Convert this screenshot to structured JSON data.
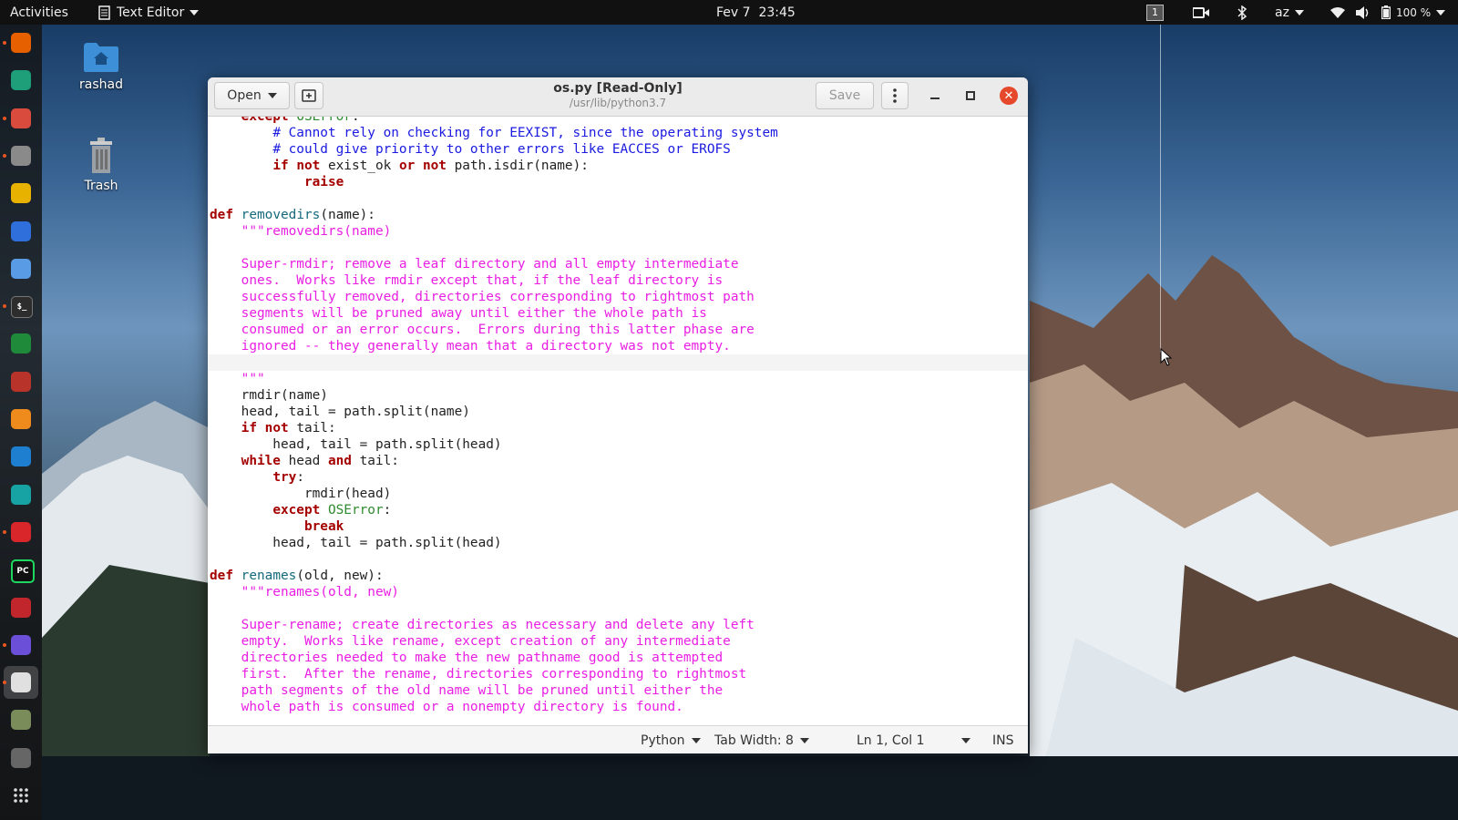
{
  "topbar": {
    "activities": "Activities",
    "app_menu": "Text Editor",
    "clock": "Fev 7  23:45",
    "workspace": "1",
    "keyboard_layout": "az",
    "battery": "100 %"
  },
  "desktop": {
    "home_label": "rashad",
    "trash_label": "Trash"
  },
  "window": {
    "open_label": "Open",
    "title": "os.py [Read-Only]",
    "subtitle": "/usr/lib/python3.7",
    "save_label": "Save"
  },
  "code_lines": [
    [
      {
        "t": "    "
      },
      {
        "t": "except",
        "c": "kw"
      },
      {
        "t": " "
      },
      {
        "t": "OSError",
        "c": "ex"
      },
      {
        "t": ":"
      }
    ],
    [
      {
        "t": "        "
      },
      {
        "t": "# Cannot rely on checking for EEXIST, since the operating system",
        "c": "cm"
      }
    ],
    [
      {
        "t": "        "
      },
      {
        "t": "# could give priority to other errors like EACCES or EROFS",
        "c": "cm"
      }
    ],
    [
      {
        "t": "        "
      },
      {
        "t": "if",
        "c": "kw"
      },
      {
        "t": " "
      },
      {
        "t": "not",
        "c": "kw"
      },
      {
        "t": " exist_ok "
      },
      {
        "t": "or",
        "c": "kw"
      },
      {
        "t": " "
      },
      {
        "t": "not",
        "c": "kw"
      },
      {
        "t": " path.isdir(name):"
      }
    ],
    [
      {
        "t": "            "
      },
      {
        "t": "raise",
        "c": "kw"
      }
    ],
    [
      {
        "t": ""
      }
    ],
    [
      {
        "t": "def",
        "c": "kw"
      },
      {
        "t": " "
      },
      {
        "t": "removedirs",
        "c": "fn"
      },
      {
        "t": "(name):"
      }
    ],
    [
      {
        "t": "    "
      },
      {
        "t": "\"\"\"removedirs(name)",
        "c": "st"
      }
    ],
    [
      {
        "t": ""
      }
    ],
    [
      {
        "t": "    "
      },
      {
        "t": "Super-rmdir; remove a leaf directory and all empty intermediate",
        "c": "st"
      }
    ],
    [
      {
        "t": "    "
      },
      {
        "t": "ones.  Works like rmdir except that, if the leaf directory is",
        "c": "st"
      }
    ],
    [
      {
        "t": "    "
      },
      {
        "t": "successfully removed, directories corresponding to rightmost path",
        "c": "st"
      }
    ],
    [
      {
        "t": "    "
      },
      {
        "t": "segments will be pruned away until either the whole path is",
        "c": "st"
      }
    ],
    [
      {
        "t": "    "
      },
      {
        "t": "consumed or an error occurs.  Errors during this latter phase are",
        "c": "st"
      }
    ],
    [
      {
        "t": "    "
      },
      {
        "t": "ignored -- they generally mean that a directory was not empty.",
        "c": "st"
      }
    ],
    [
      {
        "t": ""
      }
    ],
    [
      {
        "t": "    "
      },
      {
        "t": "\"\"\"",
        "c": "st"
      }
    ],
    [
      {
        "t": "    rmdir(name)"
      }
    ],
    [
      {
        "t": "    head, tail = path.split(name)"
      }
    ],
    [
      {
        "t": "    "
      },
      {
        "t": "if",
        "c": "kw"
      },
      {
        "t": " "
      },
      {
        "t": "not",
        "c": "kw"
      },
      {
        "t": " tail:"
      }
    ],
    [
      {
        "t": "        head, tail = path.split(head)"
      }
    ],
    [
      {
        "t": "    "
      },
      {
        "t": "while",
        "c": "kw"
      },
      {
        "t": " head "
      },
      {
        "t": "and",
        "c": "kw"
      },
      {
        "t": " tail:"
      }
    ],
    [
      {
        "t": "        "
      },
      {
        "t": "try",
        "c": "kw"
      },
      {
        "t": ":"
      }
    ],
    [
      {
        "t": "            rmdir(head)"
      }
    ],
    [
      {
        "t": "        "
      },
      {
        "t": "except",
        "c": "kw"
      },
      {
        "t": " "
      },
      {
        "t": "OSError",
        "c": "ex"
      },
      {
        "t": ":"
      }
    ],
    [
      {
        "t": "            "
      },
      {
        "t": "break",
        "c": "kw"
      }
    ],
    [
      {
        "t": "        head, tail = path.split(head)"
      }
    ],
    [
      {
        "t": ""
      }
    ],
    [
      {
        "t": "def",
        "c": "kw"
      },
      {
        "t": " "
      },
      {
        "t": "renames",
        "c": "fn"
      },
      {
        "t": "(old, new):"
      }
    ],
    [
      {
        "t": "    "
      },
      {
        "t": "\"\"\"renames(old, new)",
        "c": "st"
      }
    ],
    [
      {
        "t": ""
      }
    ],
    [
      {
        "t": "    "
      },
      {
        "t": "Super-rename; create directories as necessary and delete any left",
        "c": "st"
      }
    ],
    [
      {
        "t": "    "
      },
      {
        "t": "empty.  Works like rename, except creation of any intermediate",
        "c": "st"
      }
    ],
    [
      {
        "t": "    "
      },
      {
        "t": "directories needed to make the new pathname good is attempted",
        "c": "st"
      }
    ],
    [
      {
        "t": "    "
      },
      {
        "t": "first.  After the rename, directories corresponding to rightmost",
        "c": "st"
      }
    ],
    [
      {
        "t": "    "
      },
      {
        "t": "path segments of the old name will be pruned until either the",
        "c": "st"
      }
    ],
    [
      {
        "t": "    "
      },
      {
        "t": "whole path is consumed or a nonempty directory is found.",
        "c": "st"
      }
    ]
  ],
  "statusbar": {
    "language": "Python",
    "tab_width": "Tab Width: 8",
    "position": "Ln 1, Col 1",
    "mode": "INS"
  },
  "dock": [
    {
      "name": "firefox-icon",
      "color": "#e66000"
    },
    {
      "name": "snap-store-icon",
      "color": "#1e9f7a"
    },
    {
      "name": "document-viewer-icon",
      "color": "#d94c3d"
    },
    {
      "name": "archive-manager-icon",
      "color": "#8a8a8a"
    },
    {
      "name": "rhythmbox-icon",
      "color": "#e8b200"
    },
    {
      "name": "libreoffice-writer-icon",
      "color": "#2f6fdb"
    },
    {
      "name": "software-updater-icon",
      "color": "#5a9be6"
    },
    {
      "name": "terminal-icon",
      "color": "#2d2d2d"
    },
    {
      "name": "nvidia-icon",
      "color": "#1e8a3a"
    },
    {
      "name": "settings-gear-icon",
      "color": "#b8342a"
    },
    {
      "name": "sublime-text-icon",
      "color": "#ef8b1c"
    },
    {
      "name": "vscode-icon",
      "color": "#1e7fd1"
    },
    {
      "name": "arduino-icon",
      "color": "#17a3a3"
    },
    {
      "name": "flameshot-icon",
      "color": "#d9262b"
    },
    {
      "name": "pycharm-icon",
      "color": "#19a85a"
    },
    {
      "name": "screen-recorder-icon",
      "color": "#c0262b"
    },
    {
      "name": "media-player-icon",
      "color": "#6b4fd8"
    },
    {
      "name": "text-editor-icon",
      "color": "#e0e0e0"
    },
    {
      "name": "spreadsheet-icon",
      "color": "#7a8c5a"
    },
    {
      "name": "webcam-icon",
      "color": "#666666"
    },
    {
      "name": "show-applications-icon",
      "color": "transparent"
    }
  ]
}
